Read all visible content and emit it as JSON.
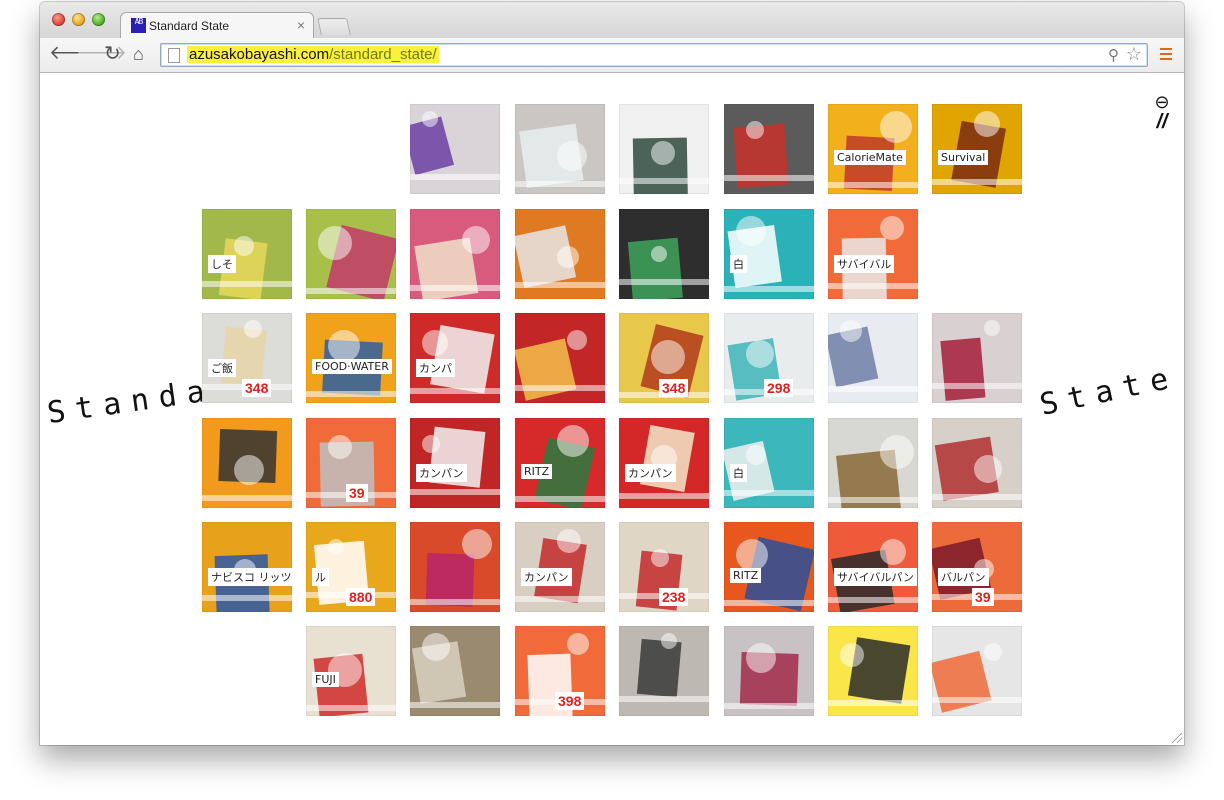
{
  "browser": {
    "tab_title": "Standard State",
    "tab_close": "×",
    "url_host": "azusakobayashi.com",
    "url_path": "/standard_state/",
    "back_icon": "🡐",
    "forward_icon": "🡒",
    "reload_icon": "↻",
    "home_icon": "⌂",
    "search_icon": "⚲",
    "star_icon": "☆",
    "favicon_text": "AB"
  },
  "page": {
    "title_left": "Standard",
    "title_right": "State",
    "corner_icon_top": "⊖",
    "corner_icon_bottom": "//"
  },
  "tiles": [
    {
      "id": "r0c2",
      "bg": "#d9d4d7",
      "accent": "#6b3fa3",
      "text": "",
      "price": ""
    },
    {
      "id": "r0c3",
      "bg": "#c9c6c3",
      "accent": "#e8eef0",
      "text": "",
      "price": ""
    },
    {
      "id": "r0c4",
      "bg": "#f0f0f0",
      "accent": "#2e4a3e",
      "text": "",
      "price": ""
    },
    {
      "id": "r0c5",
      "bg": "#5b5b5b",
      "accent": "#c8312c",
      "text": "",
      "price": ""
    },
    {
      "id": "r0c6",
      "bg": "#f2b01c",
      "accent": "#c0392b",
      "text": "CalorieMate",
      "price": ""
    },
    {
      "id": "r0c7",
      "bg": "#e0a500",
      "accent": "#7a2b12",
      "text": "Survival",
      "price": ""
    },
    {
      "id": "r1c0",
      "bg": "#a3b84a",
      "accent": "#e8d75a",
      "text": "しそ",
      "price": ""
    },
    {
      "id": "r1c1",
      "bg": "#a8c04a",
      "accent": "#c33a6a",
      "text": "",
      "price": ""
    },
    {
      "id": "r1c2",
      "bg": "#d85b7e",
      "accent": "#f0e2c8",
      "text": "",
      "price": ""
    },
    {
      "id": "r1c3",
      "bg": "#e07a22",
      "accent": "#e6e6e6",
      "text": "",
      "price": ""
    },
    {
      "id": "r1c4",
      "bg": "#2e2e2e",
      "accent": "#3ea35a",
      "text": "",
      "price": ""
    },
    {
      "id": "r1c5",
      "bg": "#2ab2b8",
      "accent": "#ffffff",
      "text": "白",
      "price": ""
    },
    {
      "id": "r1c6",
      "bg": "#f06a3a",
      "accent": "#e9e9e9",
      "text": "サバイバル",
      "price": ""
    },
    {
      "id": "r2c0",
      "bg": "#dcdcd8",
      "accent": "#e8d5a8",
      "text": "ご飯",
      "price": "348"
    },
    {
      "id": "r2c1",
      "bg": "#f0a21c",
      "accent": "#2d5fa0",
      "text": "FOOD·WATER",
      "price": ""
    },
    {
      "id": "r2c2",
      "bg": "#cf2a2a",
      "accent": "#f2f2f2",
      "text": "カンパ",
      "price": ""
    },
    {
      "id": "r2c3",
      "bg": "#c22626",
      "accent": "#f2c04a",
      "text": "",
      "price": ""
    },
    {
      "id": "r2c4",
      "bg": "#e8c84a",
      "accent": "#b23a1a",
      "text": "",
      "price": "348"
    },
    {
      "id": "r2c5",
      "bg": "#e9ecec",
      "accent": "#3eb5b8",
      "text": "",
      "price": "298"
    },
    {
      "id": "r2c6",
      "bg": "#e8ebf0",
      "accent": "#6f7fa8",
      "text": "",
      "price": ""
    },
    {
      "id": "r2c7",
      "bg": "#d9d0d2",
      "accent": "#a31f3a",
      "text": "",
      "price": ""
    },
    {
      "id": "r3c0",
      "bg": "#f29a1c",
      "accent": "#333333",
      "text": "",
      "price": ""
    },
    {
      "id": "r3c1",
      "bg": "#f06a3a",
      "accent": "#bfbfbf",
      "text": "",
      "price": "39"
    },
    {
      "id": "r3c2",
      "bg": "#c02626",
      "accent": "#f2f2f2",
      "text": "カンパン",
      "price": ""
    },
    {
      "id": "r3c3",
      "bg": "#d62a2a",
      "accent": "#2a7a3e",
      "text": "RITZ",
      "price": ""
    },
    {
      "id": "r3c4",
      "bg": "#d42828",
      "accent": "#f2e8c8",
      "text": "カンパン",
      "price": ""
    },
    {
      "id": "r3c5",
      "bg": "#3cb8bc",
      "accent": "#f0f0f0",
      "text": "白",
      "price": ""
    },
    {
      "id": "r3c6",
      "bg": "#d8d8d2",
      "accent": "#8a6a3a",
      "text": "",
      "price": ""
    },
    {
      "id": "r3c7",
      "bg": "#d6d0c8",
      "accent": "#b03030",
      "text": "",
      "price": ""
    },
    {
      "id": "r4c0",
      "bg": "#e8a11a",
      "accent": "#2a58a8",
      "text": "ナビスコ リッツ",
      "price": ""
    },
    {
      "id": "r4c1",
      "bg": "#e9a81c",
      "accent": "#ffffff",
      "text": "ル",
      "price": "880"
    },
    {
      "id": "r4c2",
      "bg": "#d84a2a",
      "accent": "#b8256a",
      "text": "",
      "price": ""
    },
    {
      "id": "r4c3",
      "bg": "#d8cfc2",
      "accent": "#c22a2a",
      "text": "カンパン",
      "price": ""
    },
    {
      "id": "r4c4",
      "bg": "#e0d6c6",
      "accent": "#c22a2a",
      "text": "",
      "price": "238"
    },
    {
      "id": "r4c5",
      "bg": "#e8581e",
      "accent": "#2a4f9a",
      "text": "RITZ",
      "price": ""
    },
    {
      "id": "r4c6",
      "bg": "#ee5a3a",
      "accent": "#2a2a2a",
      "text": "サバイバルパン",
      "price": ""
    },
    {
      "id": "r4c7",
      "bg": "#ed6a3a",
      "accent": "#7a1a2a",
      "text": "バルパン",
      "price": "39"
    },
    {
      "id": "r5c1",
      "bg": "#e8e0d0",
      "accent": "#d02a2a",
      "text": "FUJI",
      "price": ""
    },
    {
      "id": "r5c2",
      "bg": "#9a8a70",
      "accent": "#d8d0c0",
      "text": "",
      "price": ""
    },
    {
      "id": "r5c3",
      "bg": "#f06a3a",
      "accent": "#ffffff",
      "text": "",
      "price": "398"
    },
    {
      "id": "r5c4",
      "bg": "#bdb8b2",
      "accent": "#3a3a3a",
      "text": "",
      "price": ""
    },
    {
      "id": "r5c5",
      "bg": "#c8c2c4",
      "accent": "#a12a4a",
      "text": "",
      "price": ""
    },
    {
      "id": "r5c6",
      "bg": "#fbe64a",
      "accent": "#2a2a2a",
      "text": "",
      "price": ""
    },
    {
      "id": "r5c7",
      "bg": "#e6e6e6",
      "accent": "#f06a3a",
      "text": "",
      "price": ""
    }
  ]
}
